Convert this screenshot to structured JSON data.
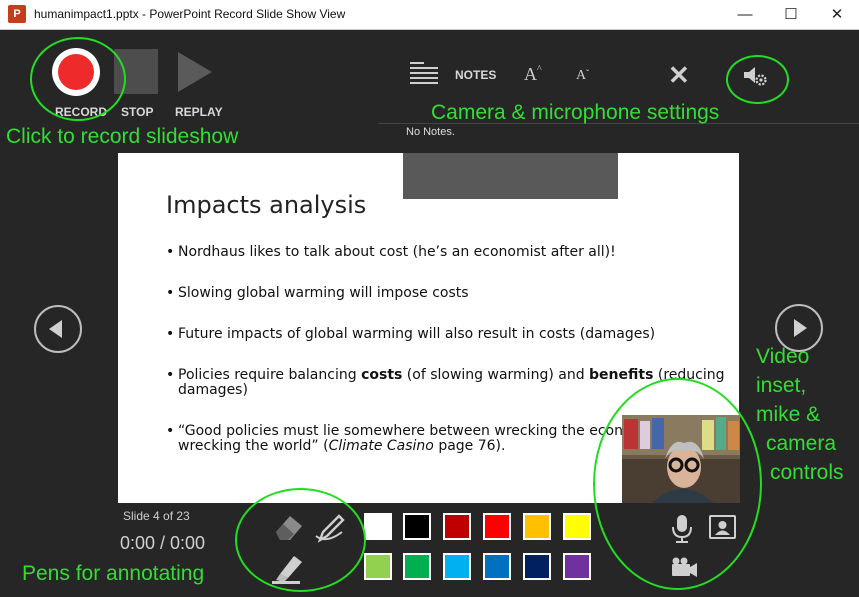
{
  "window": {
    "title": "humanimpact1.pptx - PowerPoint Record Slide Show View",
    "minimize": "—",
    "maximize": "☐",
    "close": "✕",
    "app_icon": "P"
  },
  "toolbar": {
    "record_label": "RECORD",
    "stop_label": "STOP",
    "replay_label": "REPLAY",
    "notes_label": "NOTES",
    "font_up": "A",
    "font_down": "A",
    "close_glyph": "✕"
  },
  "notes": {
    "text": "No Notes."
  },
  "slide": {
    "title": "Impacts analysis",
    "bullets": [
      "Nordhaus likes to talk about cost (he’s an economist after all)!",
      "Slowing global warming will impose costs",
      "Future impacts of global warming will also result in costs (damages)",
      {
        "a": "Policies require balancing ",
        "b": "costs",
        "c": " (of slowing warming) and ",
        "d": "benefits",
        "e": " (reducing damages)"
      },
      {
        "a": "“Good policies must lie somewhere between wrecking the economy and wrecking the world” (",
        "b": "Climate Casino",
        "c": " page 76)."
      }
    ]
  },
  "status": {
    "slide_counter": "Slide 4 of 23",
    "timer": "0:00  /  0:00"
  },
  "pen_colors": {
    "row1": [
      "#ffffff",
      "#000000",
      "#c00000",
      "#ff0000",
      "#ffc000",
      "#ffff00"
    ],
    "row2": [
      "#92d050",
      "#00b050",
      "#00b0f0",
      "#0070c0",
      "#002060",
      "#7030a0"
    ]
  },
  "annotations": {
    "record": "Click to record slideshow",
    "settings": "Camera & microphone settings",
    "pens": "Pens for annotating",
    "video_lines": [
      "Video",
      "inset,",
      "mike &",
      "camera",
      "controls"
    ]
  },
  "colors": {
    "accent_annotation": "#22dd22",
    "record_red": "#ee2a2a",
    "background": "#262626"
  },
  "icons": [
    "powerpoint-icon",
    "record-icon",
    "stop-icon",
    "replay-icon",
    "notes-icon",
    "font-increase-icon",
    "font-decrease-icon",
    "exit-icon",
    "settings-icon",
    "prev-slide-icon",
    "next-slide-icon",
    "eraser-icon",
    "pen-icon",
    "highlighter-icon",
    "microphone-icon",
    "camera-toggle-icon",
    "video-camera-icon"
  ]
}
